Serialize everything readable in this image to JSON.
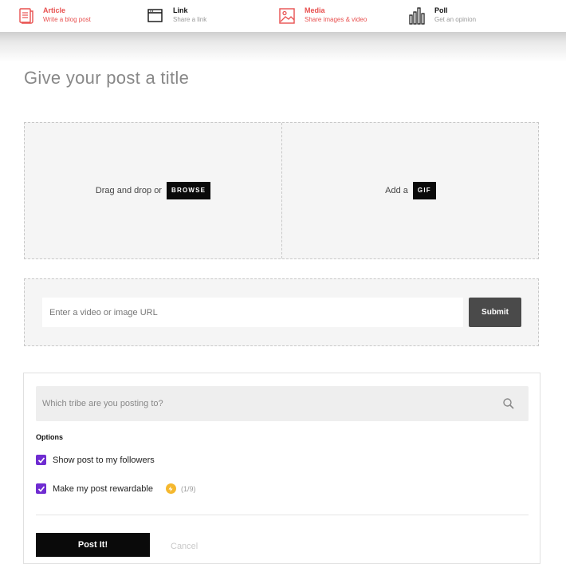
{
  "post_types": [
    {
      "name": "Article",
      "sub": "Write a blog post",
      "icon": "article-icon"
    },
    {
      "name": "Link",
      "sub": "Share a link",
      "icon": "link-window-icon"
    },
    {
      "name": "Media",
      "sub": "Share images & video",
      "icon": "image-icon"
    },
    {
      "name": "Poll",
      "sub": "Get an opinion",
      "icon": "poll-bars-icon"
    }
  ],
  "title_placeholder": "Give your post a title",
  "upload": {
    "drag_text": "Drag and drop or",
    "browse_label": "BROWSE",
    "add_text": "Add a",
    "gif_label": "GIF"
  },
  "url": {
    "placeholder": "Enter a video or image URL",
    "submit_label": "Submit"
  },
  "tribe": {
    "placeholder": "Which tribe are you posting to?",
    "icon": "search-icon"
  },
  "options": {
    "heading": "Options",
    "items": [
      {
        "label": "Show post to my followers",
        "checked": true
      },
      {
        "label": "Make my post rewardable",
        "checked": true,
        "count": "(1/9)",
        "icon": "coin-icon"
      }
    ]
  },
  "actions": {
    "post_label": "Post It!",
    "cancel_label": "Cancel"
  },
  "colors": {
    "accent_red": "#e8504f",
    "checkbox_purple": "#6f2cd1",
    "coin_yellow": "#f5b82e"
  }
}
